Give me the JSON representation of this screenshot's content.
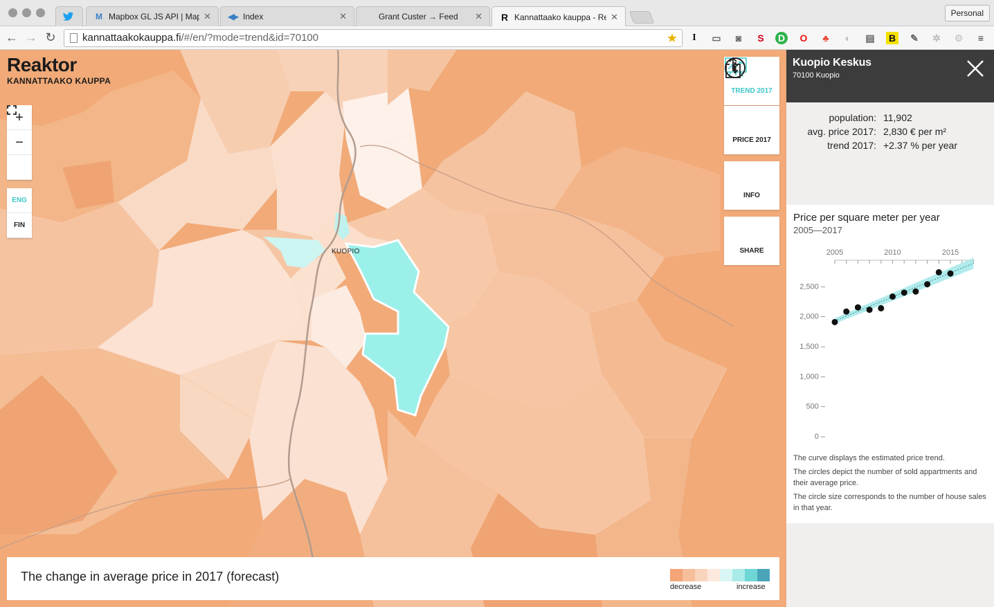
{
  "browser": {
    "tabs": [
      {
        "label": "",
        "icon": "twitter-icon"
      },
      {
        "label": "Mapbox GL JS API | Mapbox",
        "icon": "mapbox-icon"
      },
      {
        "label": "Index",
        "icon": "index-icon"
      },
      {
        "label": "Grant Custer → Feed",
        "icon": "feed-icon"
      },
      {
        "label": "Kannattaako kauppa - Reaktor",
        "icon": "reaktor-icon"
      }
    ],
    "profile": "Personal",
    "url_host": "kannattaakokauppa.fi",
    "url_path": "/#/en/?mode=trend&id=70100"
  },
  "map": {
    "logo_name": "Reaktor",
    "logo_sub": "KANNATTAAKO KAUPPA",
    "zoom_in": "+",
    "zoom_out": "−",
    "lang_eng": "ENG",
    "lang_fin": "FIN",
    "city_label": "KUOPIO",
    "modes": [
      {
        "label": "TREND 2017",
        "icon": "trend-chart-icon",
        "active": true
      },
      {
        "label": "PRICE 2017",
        "icon": "euro-icon",
        "active": false
      },
      {
        "label": "INFO",
        "icon": "info-icon",
        "active": false
      },
      {
        "label": "SHARE",
        "icon": "share-icon",
        "active": false
      }
    ]
  },
  "legend": {
    "title": "The change in average price in 2017 (forecast)",
    "low_label": "decrease",
    "high_label": "increase",
    "colors": [
      "#f3a578",
      "#f6bf9a",
      "#f9d4bd",
      "#fce8dc",
      "#d9f6f4",
      "#a9ebe8",
      "#6fd6d6",
      "#4aa5b8"
    ]
  },
  "panel": {
    "title": "Kuopio Keskus",
    "subtitle": "70100 Kuopio",
    "stats": [
      {
        "key": "population:",
        "value": "11,902"
      },
      {
        "key": "avg. price 2017:",
        "value": "2,830 € per m²"
      },
      {
        "key": "trend 2017:",
        "value": "+2.37 % per year"
      }
    ],
    "chart_title": "Price per square meter per year",
    "chart_subtitle": "2005—2017",
    "notes": [
      "The curve displays the estimated price trend.",
      "The circles depict the number of sold appartments and their average price.",
      "The circle size corresponds to the number of house sales in that year."
    ]
  },
  "chart_data": {
    "type": "scatter",
    "title": "Price per square meter per year",
    "subtitle": "2005—2017",
    "x_ticks": [
      2005,
      2010,
      2015
    ],
    "y_ticks": [
      0,
      500,
      1000,
      1500,
      2000,
      2500
    ],
    "y_tick_labels": [
      "0 –",
      "500 –",
      "1,000 –",
      "1,500 –",
      "2,000 –",
      "2,500 –"
    ],
    "xlim": [
      2005,
      2017
    ],
    "ylim": [
      0,
      2700
    ],
    "points": [
      {
        "x": 2005,
        "y": 1900
      },
      {
        "x": 2006,
        "y": 2075
      },
      {
        "x": 2007,
        "y": 2145
      },
      {
        "x": 2008,
        "y": 2105
      },
      {
        "x": 2009,
        "y": 2130
      },
      {
        "x": 2010,
        "y": 2325
      },
      {
        "x": 2011,
        "y": 2390
      },
      {
        "x": 2012,
        "y": 2410
      },
      {
        "x": 2013,
        "y": 2530
      },
      {
        "x": 2014,
        "y": 2730
      },
      {
        "x": 2015,
        "y": 2710
      }
    ],
    "trend": [
      {
        "x": 2005,
        "y": 1920
      },
      {
        "x": 2017,
        "y": 2880
      }
    ]
  }
}
